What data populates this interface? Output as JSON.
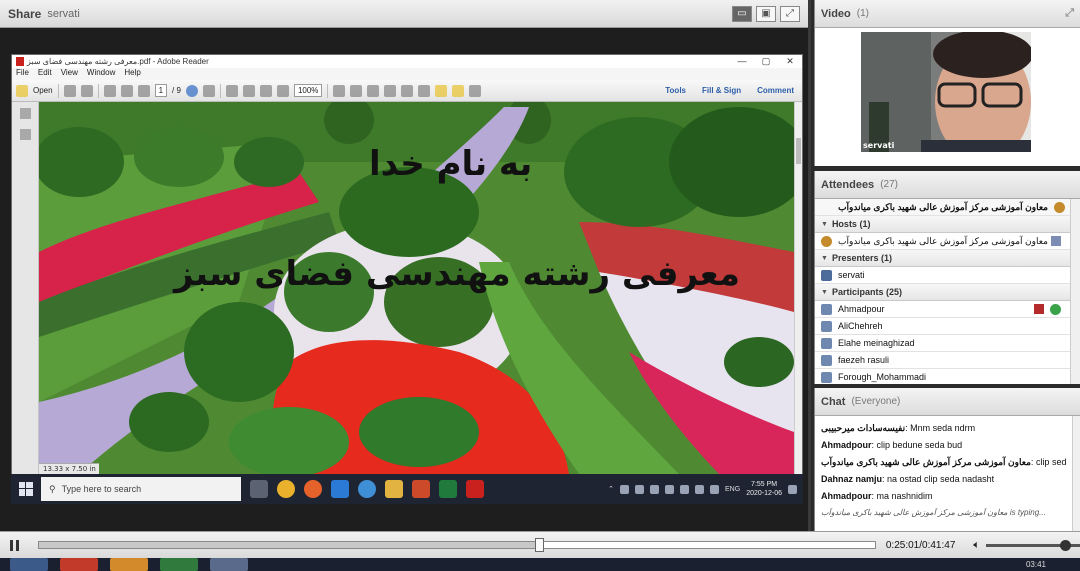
{
  "share_pod": {
    "title": "Share",
    "presenter": "servati"
  },
  "reader": {
    "window_title": "معرفی رشته مهندسی فضای سبز.pdf - Adobe Reader",
    "menu": [
      "File",
      "Edit",
      "View",
      "Window",
      "Help"
    ],
    "toolbar": {
      "open_label": "Open",
      "page_current": "1",
      "page_total": "/ 9",
      "zoom": "100%",
      "tools_label": "Tools",
      "fill_sign_label": "Fill & Sign",
      "comment_label": "Comment"
    },
    "slide": {
      "line1": "به نام خدا",
      "line2": "معرفی رشته مهندسی فضای سبز"
    },
    "page_size": "13.33 x 7.50 in"
  },
  "windows_taskbar": {
    "search_placeholder": "Type here to search",
    "language": "ENG",
    "time": "7:55 PM",
    "date": "2020-12-06"
  },
  "video_pod": {
    "title": "Video",
    "count": "(1)",
    "speaker_name": "servati"
  },
  "attendees_pod": {
    "title": "Attendees",
    "count": "(27)",
    "owner": "معاون آموزشی مرکز آموزش عالی شهید باکری میاندوآب",
    "hosts_label": "Hosts (1)",
    "hosts": [
      "معاون آموزشی مرکز آموزش عالی شهید باکری میاندوآب"
    ],
    "presenters_label": "Presenters (1)",
    "presenters": [
      "servati"
    ],
    "participants_label": "Participants (25)",
    "participants": [
      "Ahmadpour",
      "AliChehreh",
      "Elahe meinaghizad",
      "faezeh rasuli",
      "Forough_Mohammadi"
    ]
  },
  "chat_pod": {
    "title": "Chat",
    "scope": "(Everyone)",
    "messages": [
      {
        "sender": "نفیسه‌سادات میرحبیبی",
        "text": "Mnm seda ndrm"
      },
      {
        "sender": "Ahmadpour",
        "text": "clip bedune seda bud"
      },
      {
        "sender": "معاون آموزشی مرکز آموزش عالی شهید باکری میاندوآب",
        "text": "clip seda dasht"
      },
      {
        "sender": "Dahnaz namju",
        "text": "na ostad clip seda nadasht"
      },
      {
        "sender": "Ahmadpour",
        "text": "ma nashnidim"
      }
    ],
    "typing": "معاون آموزشی مرکز آموزش عالی شهید باکری میاندوآب is typing..."
  },
  "playback": {
    "time": "0:25:01/0:41:47",
    "progress": 0.599,
    "volume": 0.85
  },
  "os_clock": "03:41"
}
